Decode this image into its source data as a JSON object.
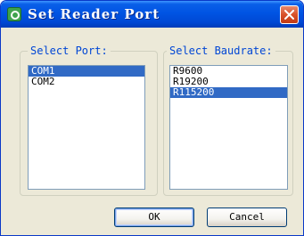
{
  "window": {
    "title": "Set Reader Port",
    "icon": "app-icon",
    "close_icon": "close-icon"
  },
  "port_group": {
    "label": "Select Port:",
    "items": [
      {
        "label": "COM1",
        "selected": true
      },
      {
        "label": "COM2",
        "selected": false
      }
    ]
  },
  "baud_group": {
    "label": "Select Baudrate:",
    "items": [
      {
        "label": "R9600",
        "selected": false
      },
      {
        "label": "R19200",
        "selected": false
      },
      {
        "label": "R115200",
        "selected": true
      }
    ]
  },
  "buttons": {
    "ok_label": "OK",
    "cancel_label": "Cancel"
  },
  "colors": {
    "titlebar": "#0054e3",
    "selection": "#316ac5",
    "group_label": "#0046d5",
    "dialog_bg": "#ece9d8",
    "close_button": "#d8512a"
  }
}
